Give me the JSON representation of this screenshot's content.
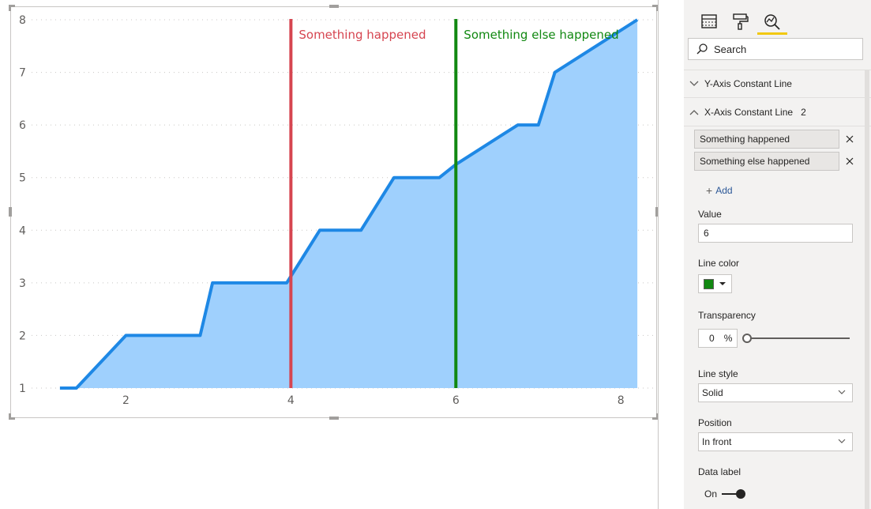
{
  "chart_data": {
    "type": "area",
    "x": [
      1.2,
      1.4,
      2.0,
      2.9,
      3.05,
      3.95,
      4.35,
      4.85,
      5.25,
      5.8,
      6.0,
      6.75,
      7.0,
      7.2,
      8.2
    ],
    "y": [
      1.0,
      1.0,
      2.0,
      2.0,
      3.0,
      3.0,
      4.0,
      4.0,
      5.0,
      5.0,
      5.25,
      6.0,
      6.0,
      7.0,
      8.0
    ],
    "xlim": [
      1.0,
      8.4
    ],
    "ylim": [
      1,
      8
    ],
    "x_ticks": [
      "2",
      "4",
      "6",
      "8"
    ],
    "y_ticks": [
      "1",
      "2",
      "3",
      "4",
      "5",
      "6",
      "7",
      "8"
    ],
    "grid": "horizontal dotted",
    "area_color": "#9fd0fd",
    "line_color": "#1e88e5",
    "constant_lines": [
      {
        "x": 4,
        "label": "Something happened",
        "color": "#d64550"
      },
      {
        "x": 6,
        "label": "Something else happened",
        "color": "#118811"
      }
    ],
    "title": "",
    "xlabel": "",
    "ylabel": ""
  },
  "pane": {
    "search_placeholder": "Search",
    "y_axis_section": "Y-Axis Constant Line",
    "x_axis_section": "X-Axis Constant Line",
    "x_axis_count": "2",
    "lines": [
      "Something happened",
      "Something else happened"
    ],
    "add_label": "Add",
    "value_label": "Value",
    "value": "6",
    "line_color_label": "Line color",
    "line_color": "#118811",
    "transparency_label": "Transparency",
    "transparency_value": "0",
    "transparency_unit": "%",
    "line_style_label": "Line style",
    "line_style_value": "Solid",
    "position_label": "Position",
    "position_value": "In front",
    "data_label_label": "Data label",
    "data_label_state": "On",
    "icons": [
      "fields-icon",
      "format-paint-icon",
      "analytics-icon",
      "search-icon",
      "chevron-down-icon",
      "chevron-up-icon",
      "close-icon"
    ]
  }
}
